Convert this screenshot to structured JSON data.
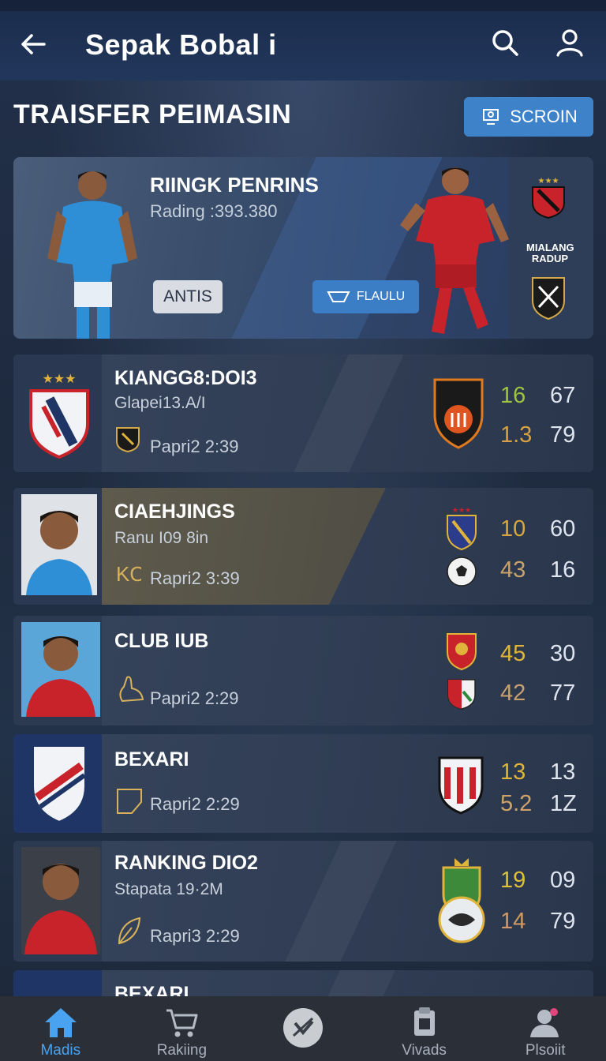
{
  "appbar": {
    "title": "Sepak Bobal i"
  },
  "section": {
    "title": "TRAISFER PEIMASIN",
    "screen_label": "SCROIN"
  },
  "hero": {
    "name": "RIINGK PENRINS",
    "sub": "Rading :393.380",
    "antis_label": "ANTIS",
    "plan_label": "FLAULU",
    "club_name": "MIALANG RADUP"
  },
  "cards": [
    {
      "name": "KIANGG8:DOI3",
      "sub": "Glapei13.A/I",
      "time": "Papri2 2:39",
      "n1": "16",
      "n2": "67",
      "n3": "1.3",
      "n4": "79",
      "c1": "#9fc53a",
      "c3": "#d7a043"
    },
    {
      "name": "CIAEHJINGS",
      "sub": "Ranu I09 8in",
      "time": "Rapri2 3:39",
      "n1": "10",
      "n2": "60",
      "n3": "43",
      "n4": "16",
      "c1": "#d9a63c",
      "c3": "#c9a26a"
    },
    {
      "name": "CLUB IUB",
      "sub": "",
      "time": "Papri2 2:29",
      "n1": "45",
      "n2": "30",
      "n3": "42",
      "n4": "77",
      "c1": "#e0b33a",
      "c3": "#c7a06e"
    },
    {
      "name": "BEXARI",
      "sub": "",
      "time": "Rapri2 2:29",
      "n1": "13",
      "n2": "13",
      "n3": "5.2",
      "n4": "1Z",
      "c1": "#e0b33a",
      "c3": "#cfa26a"
    },
    {
      "name": "RANKING DIO2",
      "sub": "Stapata 19·2M",
      "time": "Rapri3 2:29",
      "n1": "19",
      "n2": "09",
      "n3": "14",
      "n4": "79",
      "c1": "#e0c03a",
      "c3": "#d29a62"
    },
    {
      "name": "BEXARI",
      "sub": "",
      "time": "",
      "n1": "",
      "n2": "",
      "n3": "",
      "n4": ""
    }
  ],
  "nav": [
    {
      "label": "Madis",
      "icon": "home-icon",
      "active": true
    },
    {
      "label": "Rakiing",
      "icon": "cart-icon",
      "active": false
    },
    {
      "label": "",
      "icon": "compass-icon",
      "active": false
    },
    {
      "label": "Vivads",
      "icon": "clipboard-icon",
      "active": false
    },
    {
      "label": "Plsoiit",
      "icon": "profile-icon",
      "active": false
    }
  ]
}
